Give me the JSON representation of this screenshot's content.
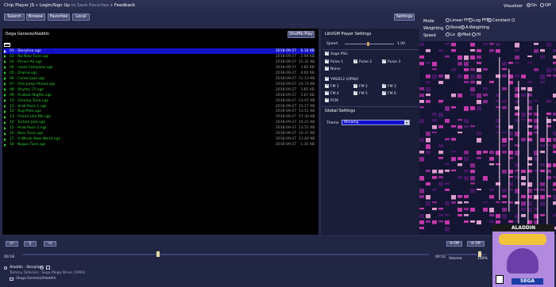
{
  "header": {
    "app_title": "Chip Player JS",
    "links": [
      "Login/Sign Up",
      "to Save Favorites",
      "Feedback"
    ],
    "buttons": [
      "Search",
      "Browse",
      "Favorites",
      "Local"
    ],
    "settings_label": "Settings"
  },
  "visualizer": {
    "label": "Visualizer",
    "on_label": "On",
    "off_label": "Off",
    "mode_label": "Mode",
    "mode_options": [
      "Linear FFT",
      "Log FFT",
      "Constant Q"
    ],
    "weighting_label": "Weighting",
    "weighting_options": [
      "None",
      "A-Weighting"
    ],
    "speed_label": "Speed",
    "speed_options": [
      "Lo",
      "Med",
      "Hi"
    ]
  },
  "browser": {
    "path": "/Sega Genesis/Aladdin",
    "shuffle_label": "Shuffle Play",
    "files": [
      {
        "name": "01 - Storyline.vgz",
        "date": "2018-09-27",
        "size": "6.16 KB",
        "selected": true
      },
      {
        "name": "02 - Na-Naw Tune.vgz",
        "date": "2018-09-27",
        "size": "2.04 KB"
      },
      {
        "name": "03 - Prince Ali.vgz",
        "date": "2018-09-27",
        "size": "15.35 KB"
      },
      {
        "name": "04 - Level Complete.vgz",
        "date": "2018-09-27",
        "size": "1.82 KB"
      },
      {
        "name": "05 - Drama.vgz",
        "date": "2018-09-27",
        "size": "4.02 KB"
      },
      {
        "name": "06 - Camel Jazz.vgz",
        "date": "2018-09-27",
        "size": "11.13 KB"
      },
      {
        "name": "07 - One Jump Ahead.vgz",
        "date": "2018-09-27",
        "size": "14.74 KB"
      },
      {
        "name": "08 - Rhythy (?).vgz",
        "date": "2018-09-27",
        "size": "1.85 KB"
      },
      {
        "name": "09 - Arabian Nights.vgz",
        "date": "2018-09-27",
        "size": "5.67 KB"
      },
      {
        "name": "10 - Gloomy Tune.vgz",
        "date": "2018-09-27",
        "size": "13.97 KB"
      },
      {
        "name": "11 - Arab Rock 1.vgz",
        "date": "2018-09-27",
        "size": "15.17 KB"
      },
      {
        "name": "12 - Rug Ride.vgz",
        "date": "2018-09-27",
        "size": "13.51 KB"
      },
      {
        "name": "13 - Friend Like Me.vgz",
        "date": "2018-09-27",
        "size": "17.30 KB"
      },
      {
        "name": "14 - Turban Jazz.vgz",
        "date": "2018-09-27",
        "size": "15.21 KB"
      },
      {
        "name": "15 - Arab Rock 2.vgz",
        "date": "2018-09-27",
        "size": "13.51 KB"
      },
      {
        "name": "16 - Boss Tune.vgz",
        "date": "2018-09-27",
        "size": "10.37 KB"
      },
      {
        "name": "17 - A Whole New World.vgz",
        "date": "2018-09-27",
        "size": "11.44 KB"
      },
      {
        "name": "18 - Bogus Tune.vgz",
        "date": "2018-09-27",
        "size": "1.35 KB"
      }
    ]
  },
  "player_settings": {
    "title": "LibVGM Player Settings",
    "speed_label": "Speed",
    "speed_value": "1.00",
    "speed_fraction": 0.45,
    "psg_group": "Sega PSG",
    "psg_channels": [
      "Pulse 1",
      "Pulse 2",
      "Pulse 3",
      "Noise"
    ],
    "fm_group": "YM2612 (OPN2)",
    "fm_channels": [
      "FM 1",
      "FM 2",
      "FM 3",
      "FM 4",
      "FM 5",
      "FM 6",
      "PCM"
    ],
    "global_title": "Global Settings",
    "theme_label": "Theme",
    "theme_value": "Winamp"
  },
  "transport": {
    "prev_label": "|<",
    "pause_label": "||",
    "next_label": ">|",
    "loop_label": "Off",
    "repeat_label": "Off",
    "elapsed": "00:18",
    "duration": "00:52",
    "progress": 0.33,
    "volume_label": "Volume",
    "volume_value": "100%",
    "volume_fraction": 0.8
  },
  "now_playing": {
    "title": "Aladdin - Storyline",
    "composer": "Tommy Tallarico - Sega Mega Drive (1993)",
    "path": "/Sega Genesis/Aladdin",
    "cover_title": "ALADDIN",
    "cover_brand": "SEGA"
  },
  "colors": {
    "accent": "#1212c8",
    "file_green": "#2fd42f"
  }
}
